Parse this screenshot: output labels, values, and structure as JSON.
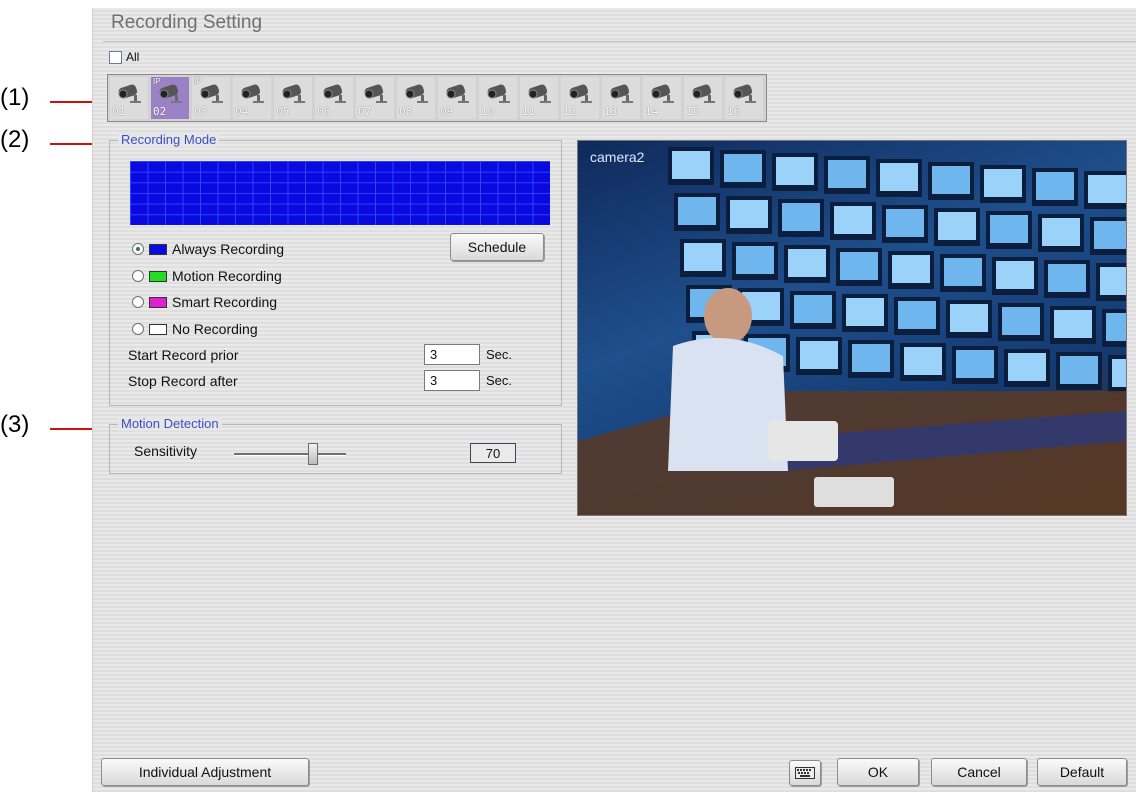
{
  "callouts": [
    "(1)",
    "(2)",
    "(3)"
  ],
  "window": {
    "title": "Recording Setting"
  },
  "all_checkbox": {
    "label": "All",
    "checked": false
  },
  "cameras": [
    {
      "num": "01",
      "ip": "",
      "selected": false
    },
    {
      "num": "02",
      "ip": "IP",
      "selected": true
    },
    {
      "num": "03",
      "ip": "IP",
      "selected": false
    },
    {
      "num": "04",
      "ip": "",
      "selected": false
    },
    {
      "num": "05",
      "ip": "",
      "selected": false
    },
    {
      "num": "06",
      "ip": "",
      "selected": false
    },
    {
      "num": "07",
      "ip": "",
      "selected": false
    },
    {
      "num": "08",
      "ip": "",
      "selected": false
    },
    {
      "num": "09",
      "ip": "",
      "selected": false
    },
    {
      "num": "10",
      "ip": "",
      "selected": false
    },
    {
      "num": "11",
      "ip": "",
      "selected": false
    },
    {
      "num": "12",
      "ip": "",
      "selected": false
    },
    {
      "num": "13",
      "ip": "",
      "selected": false
    },
    {
      "num": "14",
      "ip": "",
      "selected": false
    },
    {
      "num": "15",
      "ip": "",
      "selected": false
    },
    {
      "num": "16",
      "ip": "",
      "selected": false
    }
  ],
  "recording_mode": {
    "legend": "Recording Mode",
    "schedule_button": "Schedule",
    "options": [
      {
        "label": "Always Recording",
        "color": "#0a0ae0",
        "checked": true
      },
      {
        "label": "Motion Recording",
        "color": "#22dd22",
        "checked": false
      },
      {
        "label": "Smart Recording",
        "color": "#e020d0",
        "checked": false
      },
      {
        "label": "No Recording",
        "color": "#ffffff",
        "checked": false
      }
    ],
    "start_prior": {
      "label": "Start Record prior",
      "value": "3",
      "unit": "Sec."
    },
    "stop_after": {
      "label": "Stop Record after",
      "value": "3",
      "unit": "Sec."
    }
  },
  "motion_detection": {
    "legend": "Motion Detection",
    "sensitivity_label": "Sensitivity",
    "value": "70",
    "fraction": 0.7
  },
  "preview": {
    "camera_label": "camera2"
  },
  "footer": {
    "individual_adjustment": "Individual Adjustment",
    "ok": "OK",
    "cancel": "Cancel",
    "default": "Default",
    "keyboard_icon": "keyboard-icon"
  }
}
